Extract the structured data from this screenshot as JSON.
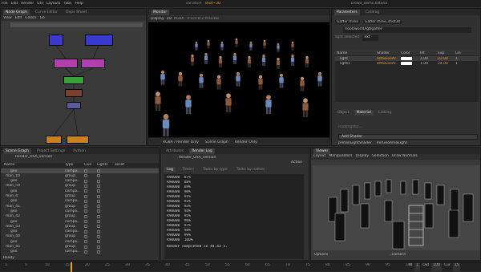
{
  "menubar": {
    "items": [
      "File",
      "Edit",
      "Render",
      "Util",
      "Layouts",
      "Tabs",
      "Help"
    ],
    "variation_label": "variation",
    "shot_value": "shot~30",
    "title": "crowd_demo.katana"
  },
  "node_graph": {
    "tabs": [
      "Node Graph",
      "Curve Editor",
      "Dope Sheet"
    ],
    "menu": [
      "View",
      "Edit",
      "Colors",
      "Go"
    ]
  },
  "monitor": {
    "tab": "Monitor",
    "display_label": "Display",
    "display_value": "2D",
    "status": "Tr  0.0  B:2  Preview",
    "res_label": "RGBA",
    "footer_left": "RGBA / Render Only",
    "footer_mid": "Scene Graph",
    "footer_right": "Render Only"
  },
  "parameters": {
    "tabs": [
      "Parameters",
      "Catalog"
    ],
    "node_name": "GafferThree",
    "node_name2": "GafferThree_shot30",
    "path": "/root/world/lgt/gaffer",
    "light_selected_label": "light selected",
    "light_selected_value": "ext",
    "columns": [
      "Name",
      "Shader",
      "Color",
      "Int",
      "Exp",
      "Lin"
    ],
    "rows": [
      {
        "name": "light",
        "shader": "RMSGeoAr..",
        "int": "1.00",
        "exp": "22.00",
        "lin": "1"
      },
      {
        "name": "light1",
        "shader": "RMSGeoAr..",
        "int": "1.00",
        "exp": "24.00",
        "lin": "1"
      }
    ],
    "subtabs": [
      "Object",
      "Material",
      "Linking"
    ],
    "shader_path": "/root/lights/...",
    "add_shader": "Add Shader",
    "shader_node": "prmanLightShader",
    "shader_name": "PxrGeoAreaLight"
  },
  "scene_graph": {
    "tabs": [
      "Scene Graph",
      "Project Settings",
      "Python"
    ],
    "render_label": "Render_USA_version",
    "columns": [
      "Name",
      "Type",
      "Live",
      "Lights",
      "asset"
    ],
    "rows": [
      {
        "name": "geo",
        "type": "compo.."
      },
      {
        "name": "man_10",
        "type": "group"
      },
      {
        "name": "geo",
        "type": "compo.."
      },
      {
        "name": "man_59",
        "type": "group"
      },
      {
        "name": "geo",
        "type": "compo.."
      },
      {
        "name": "man_4",
        "type": "group"
      },
      {
        "name": "geo",
        "type": "compo.."
      },
      {
        "name": "man_41",
        "type": "group"
      },
      {
        "name": "geo",
        "type": "compo.."
      },
      {
        "name": "man_42",
        "type": "group"
      },
      {
        "name": "geo",
        "type": "compo.."
      },
      {
        "name": "man_43",
        "type": "group"
      },
      {
        "name": "geo",
        "type": "compo.."
      },
      {
        "name": "man_44",
        "type": "group"
      },
      {
        "name": "geo",
        "type": "compo.."
      },
      {
        "name": "man_45",
        "type": "group"
      },
      {
        "name": "geo",
        "type": "compo.."
      }
    ],
    "footer": "Ready"
  },
  "render_log": {
    "tabs": [
      "Attributes",
      "Render Log"
    ],
    "title": "Render_USA_version",
    "subtabs": [
      "Log",
      "Timers",
      "Tasks by type",
      "Tasks by names"
    ],
    "lines": [
      [
        "R90000",
        "87%"
      ],
      [
        "R90000",
        "88%"
      ],
      [
        "R90000",
        "89%"
      ],
      [
        "R90000",
        "90%"
      ],
      [
        "R90000",
        "91%"
      ],
      [
        "R90000",
        "92%"
      ],
      [
        "R90000",
        "93%"
      ],
      [
        "R90000",
        "94%"
      ],
      [
        "R90000",
        "95%"
      ],
      [
        "R90000",
        "96%"
      ],
      [
        "R90000",
        "97%"
      ],
      [
        "R90000",
        "98%"
      ],
      [
        "R90000",
        "99%"
      ],
      [
        "R90000",
        "100%"
      ]
    ],
    "completed": "Render completed in 44.43 s.",
    "action_label": "Action"
  },
  "viewer": {
    "tabs": [
      "Viewer"
    ],
    "menu": [
      "Layout",
      "Manipulators",
      "Display",
      "Selection",
      "Draw Normals"
    ],
    "footer_left": "Options",
    "footer_right": "..camera"
  },
  "timeline": {
    "ticks": [
      "1",
      "5",
      "10",
      "15",
      "20",
      "25",
      "30",
      "35",
      "40",
      "45",
      "50",
      "55",
      "60",
      "65",
      "70",
      "75",
      "80",
      "85",
      "90",
      "95",
      "100"
    ],
    "in_label": "In",
    "in_value": "1",
    "out_label": "Out",
    "out_value": "100",
    "cur_label": "Cur",
    "cur_value": "15",
    "inc_label": "Inc",
    "inc_value": "1"
  },
  "colors": {
    "accent": "#f0a020",
    "node_blue": "#3a3ad0",
    "node_pink": "#b040b0",
    "node_green": "#3aa03a",
    "node_orange": "#c88020"
  }
}
